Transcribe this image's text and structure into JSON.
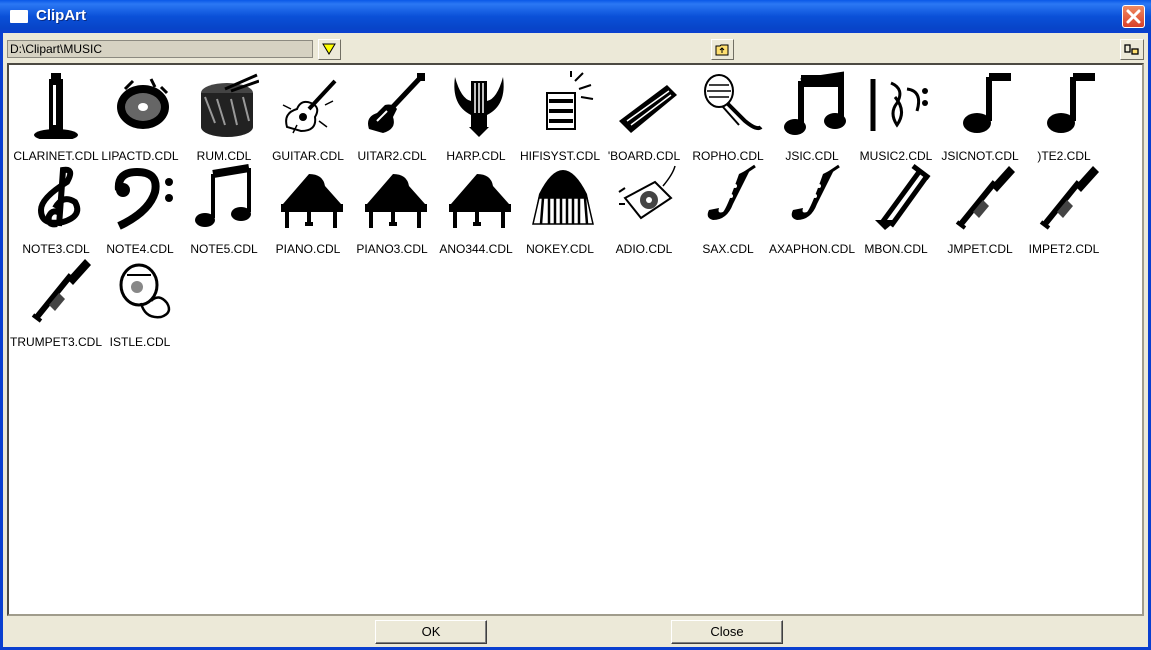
{
  "window": {
    "title": "ClipArt"
  },
  "toolbar": {
    "path": "D:\\Clipart\\MUSIC"
  },
  "items": [
    {
      "label": "CLARINET.CDL",
      "icon": "clarinet-icon"
    },
    {
      "label": "LIPACTD.CDL",
      "icon": "cd-icon"
    },
    {
      "label": "RUM.CDL",
      "icon": "drum-icon"
    },
    {
      "label": "GUITAR.CDL",
      "icon": "guitar-icon"
    },
    {
      "label": "UITAR2.CDL",
      "icon": "electric-guitar-icon"
    },
    {
      "label": "HARP.CDL",
      "icon": "lyre-icon"
    },
    {
      "label": "HIFISYST.CDL",
      "icon": "hifi-icon"
    },
    {
      "label": "'BOARD.CDL",
      "icon": "keyboard-icon"
    },
    {
      "label": "ROPHO.CDL",
      "icon": "microphone-icon"
    },
    {
      "label": "JSIC.CDL",
      "icon": "music-notes-icon"
    },
    {
      "label": "MUSIC2.CDL",
      "icon": "clef-notes-icon"
    },
    {
      "label": "JSICNOT.CDL",
      "icon": "eighth-note-icon"
    },
    {
      "label": ")TE2.CDL",
      "icon": "eighth-note-icon"
    },
    {
      "label": "NOTE3.CDL",
      "icon": "treble-clef-icon"
    },
    {
      "label": "NOTE4.CDL",
      "icon": "bass-clef-icon"
    },
    {
      "label": "NOTE5.CDL",
      "icon": "beamed-notes-icon"
    },
    {
      "label": "PIANO.CDL",
      "icon": "grand-piano-icon"
    },
    {
      "label": "PIANO3.CDL",
      "icon": "grand-piano-icon"
    },
    {
      "label": "ANO344.CDL",
      "icon": "grand-piano-icon"
    },
    {
      "label": "NOKEY.CDL",
      "icon": "piano-keys-icon"
    },
    {
      "label": "ADIO.CDL",
      "icon": "radio-icon"
    },
    {
      "label": "SAX.CDL",
      "icon": "saxophone-icon"
    },
    {
      "label": "AXAPHON.CDL",
      "icon": "saxophone-icon"
    },
    {
      "label": "MBON.CDL",
      "icon": "trombone-icon"
    },
    {
      "label": "JMPET.CDL",
      "icon": "trumpet-icon"
    },
    {
      "label": "IMPET2.CDL",
      "icon": "trumpet-icon"
    },
    {
      "label": "TRUMPET3.CDL",
      "icon": "trumpet-icon"
    },
    {
      "label": "ISTLE.CDL",
      "icon": "whistle-icon"
    }
  ],
  "buttons": {
    "ok": "OK",
    "close": "Close"
  }
}
